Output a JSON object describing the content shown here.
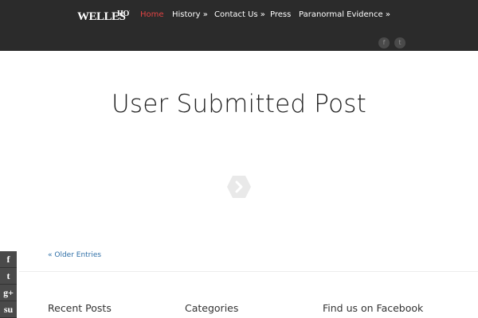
{
  "header": {
    "logo": {
      "line1": "WELLES",
      "line2": "HOUSE"
    },
    "nav": [
      {
        "label": "Home",
        "active": true
      },
      {
        "label": "History »"
      },
      {
        "label": "Contact Us »"
      },
      {
        "label": "Press"
      },
      {
        "label": "Paranormal Evidence »"
      }
    ],
    "social": [
      {
        "icon": "facebook-icon",
        "glyph": "f"
      },
      {
        "icon": "twitter-icon",
        "glyph": "t"
      }
    ]
  },
  "main": {
    "title": "User Submitted Post",
    "next_icon": "chevron-right-icon",
    "older_entries": "« Older Entries"
  },
  "footer": {
    "widgets": [
      "Recent Posts",
      "Categories",
      "Find us on Facebook"
    ]
  },
  "share_bar": [
    {
      "icon": "facebook-icon",
      "glyph": "f"
    },
    {
      "icon": "twitter-icon",
      "glyph": "t"
    },
    {
      "icon": "google-plus-icon",
      "glyph": "g+"
    },
    {
      "icon": "stumbleupon-icon",
      "glyph": "su"
    }
  ],
  "colors": {
    "topbar": "#2b2b2b",
    "active_nav": "#e04343",
    "link": "#2e6fa7"
  }
}
